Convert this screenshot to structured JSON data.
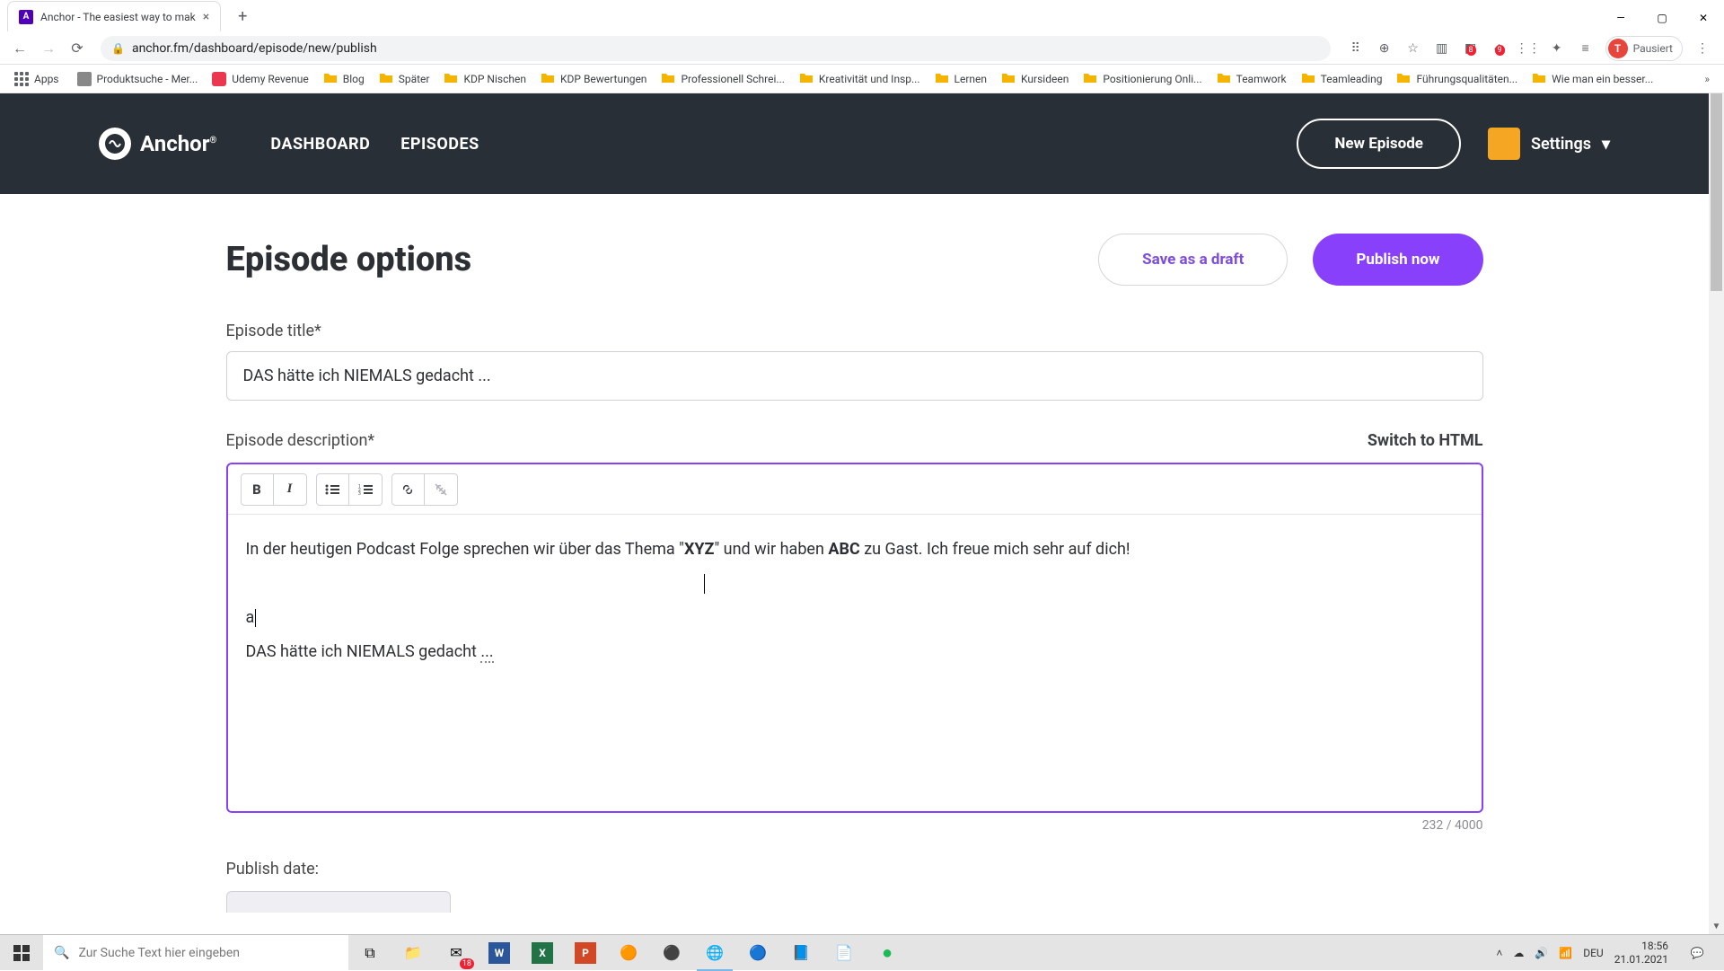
{
  "browser": {
    "tab_title": "Anchor - The easiest way to mak",
    "url": "anchor.fm/dashboard/episode/new/publish",
    "profile_label": "Pausiert",
    "profile_initial": "T"
  },
  "bookmarks": {
    "apps": "Apps",
    "items": [
      "Produktsuche - Mer...",
      "Udemy Revenue",
      "Blog",
      "Später",
      "KDP Nischen",
      "KDP Bewertungen",
      "Professionell Schrei...",
      "Kreativität und Insp...",
      "Lernen",
      "Kursideen",
      "Positionierung Onli...",
      "Teamwork",
      "Teamleading",
      "Führungsqualitäten...",
      "Wie man ein besser..."
    ]
  },
  "anchor": {
    "brand": "Anchor",
    "nav_dashboard": "DASHBOARD",
    "nav_episodes": "EPISODES",
    "new_episode": "New Episode",
    "settings": "Settings"
  },
  "page": {
    "title": "Episode options",
    "save_draft": "Save as a draft",
    "publish_now": "Publish now",
    "episode_title_label": "Episode title*",
    "episode_title_value": "DAS hätte ich NIEMALS gedacht ...",
    "episode_desc_label": "Episode description*",
    "switch_html": "Switch to HTML",
    "desc_line1_pre": "In der heutigen Podcast Folge sprechen wir über das Thema \"",
    "desc_line1_bold1": "XYZ",
    "desc_line1_mid": "\" und wir haben ",
    "desc_line1_bold2": "ABC",
    "desc_line1_post": " zu Gast. Ich freue mich sehr auf dich!",
    "desc_line_a": "a",
    "desc_line_last_pre": "DAS hätte ich NIEMALS gedacht ",
    "desc_line_last_dotted": "...",
    "char_count": "232 / 4000",
    "publish_date_label": "Publish date:"
  },
  "taskbar": {
    "search_placeholder": "Zur Suche Text hier eingeben",
    "lang": "DEU",
    "time": "18:56",
    "date": "21.01.2021"
  }
}
